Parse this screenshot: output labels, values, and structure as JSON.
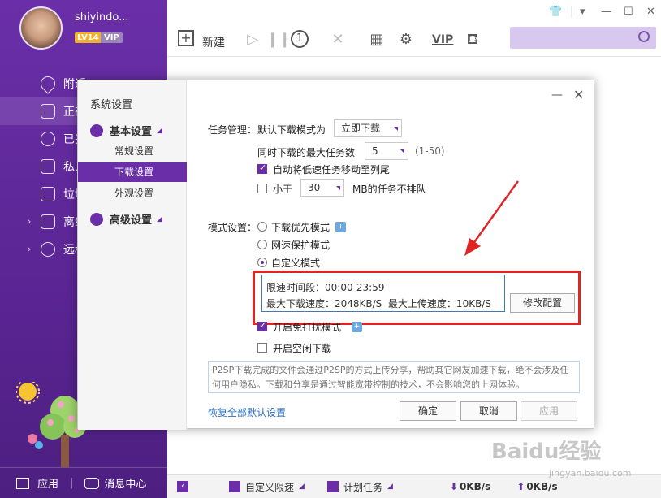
{
  "sidebar": {
    "username": "shiyindo...",
    "level": "LV14",
    "vip": "VIP",
    "items": [
      {
        "label": "附近",
        "icon": "location-icon"
      },
      {
        "label": "正在下载",
        "icon": "download-icon"
      },
      {
        "label": "已完成",
        "icon": "check-icon"
      },
      {
        "label": "私人空间",
        "icon": "lock-icon"
      },
      {
        "label": "垃圾箱",
        "icon": "trash-icon"
      },
      {
        "label": "离线空间",
        "icon": "cloud-icon"
      },
      {
        "label": "远程下载",
        "icon": "globe-icon"
      }
    ],
    "bottom": {
      "apps": "应用",
      "messages": "消息中心"
    }
  },
  "toolbar": {
    "new": "新建",
    "vip": "VIP"
  },
  "statusbar": {
    "speed_limit": "自定义限速",
    "plan_task": "计划任务",
    "down_speed": "0KB/s",
    "up_speed": "0KB/s"
  },
  "dialog": {
    "title": "系统设置",
    "nav": {
      "basic": "基本设置",
      "regular": "常规设置",
      "download": "下载设置",
      "appearance": "外观设置",
      "advanced": "高级设置"
    },
    "task": {
      "section_label": "任务管理：",
      "default_mode_label": "默认下载模式为",
      "default_mode_value": "立即下载",
      "max_tasks_label": "同时下载的最大任务数",
      "max_tasks_value": "5",
      "max_tasks_range": "(1-50)",
      "move_slow_label": "自动将低速任务移动至列尾",
      "less_than_label": "小于",
      "less_than_value": "30",
      "no_queue_label": "MB的任务不排队"
    },
    "mode": {
      "section_label": "模式设置：",
      "download_first": "下载优先模式",
      "network_protect": "网速保护模式",
      "custom": "自定义模式",
      "limit_period": "限速时间段：00:00-23:59",
      "limit_speeds": "最大下载速度：2048KB/S  最大上传速度：10KB/S",
      "edit_config": "修改配置",
      "no_disturb": "开启免打扰模式",
      "idle_download": "开启空闲下载"
    },
    "note": "P2SP下载完成的文件会通过P2SP的方式上传分享，帮助其它网友加速下载，绝不会涉及任何用户隐私。下载和分享是通过智能宽带控制的技术，不会影响您的上网体验。",
    "restore": "恢复全部默认设置",
    "ok": "确定",
    "cancel": "取消",
    "apply": "应用"
  },
  "watermark": {
    "brand": "Baidu经验",
    "url": "jingyan.baidu.com"
  },
  "colors": {
    "brand": "#6a2fa8",
    "highlight": "#e02424"
  }
}
